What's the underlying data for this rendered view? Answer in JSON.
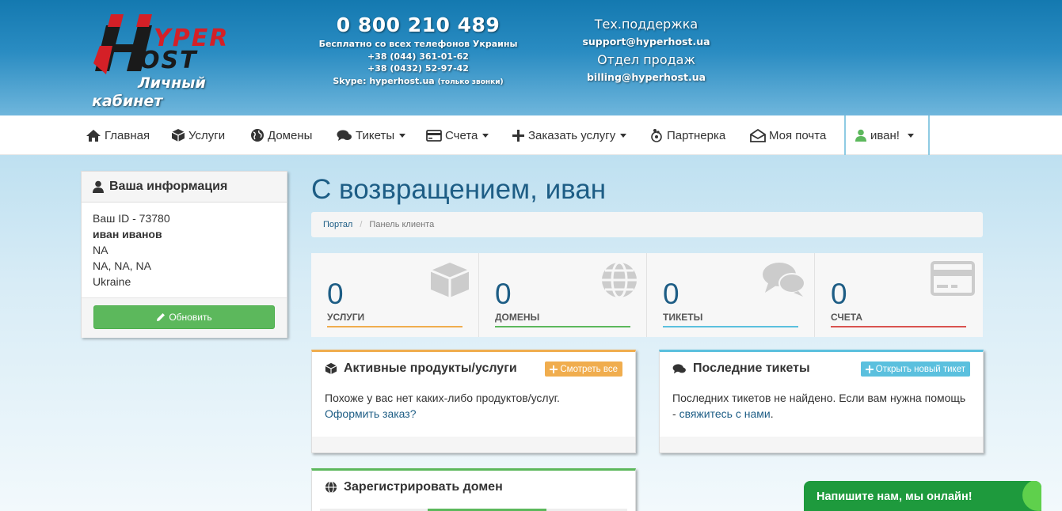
{
  "header": {
    "logo_text": "HYPER HOST",
    "logo_sub_line1": "Личный",
    "logo_sub_line2": "кабинет",
    "phone_main": "0 800 210 489",
    "phone_note": "Бесплатно со всех телефонов Украины",
    "phone_2": "+38 (044) 361-01-62",
    "phone_3": "+38 (0432) 52-97-42",
    "skype": "Skype: hyperhost.ua",
    "skype_note": "(только звонки)",
    "support_title": "Тех.поддержка",
    "support_email": "support@hyperhost.ua",
    "sales_title": "Отдел продаж",
    "sales_email": "billing@hyperhost.ua"
  },
  "nav": {
    "items": [
      {
        "label": "Главная",
        "icon": "home-icon"
      },
      {
        "label": "Услуги",
        "icon": "cube-icon"
      },
      {
        "label": "Домены",
        "icon": "globe-icon"
      },
      {
        "label": "Тикеты",
        "icon": "comments-icon",
        "dropdown": true
      },
      {
        "label": "Счета",
        "icon": "credit-card-icon",
        "dropdown": true
      },
      {
        "label": "Заказать услугу",
        "icon": "plus-icon",
        "dropdown": true
      },
      {
        "label": "Партнерка",
        "icon": "partner-icon"
      },
      {
        "label": "Моя почта",
        "icon": "envelope-icon"
      }
    ],
    "user_label": "иван!"
  },
  "sidebar": {
    "title": "Ваша информация",
    "id_line": "Ваш ID - 73780",
    "name": "иван иванов",
    "line3": "NA",
    "line4": "NA, NA, NA",
    "country": "Ukraine",
    "update_button": "Обновить"
  },
  "main": {
    "title": "С возвращением, иван",
    "breadcrumb": {
      "root": "Портал",
      "current": "Панель клиента"
    },
    "tiles": [
      {
        "value": "0",
        "label": "УСЛУГИ",
        "color": "#f0ad4e",
        "icon": "cube-icon"
      },
      {
        "value": "0",
        "label": "ДОМЕНЫ",
        "color": "#5cb85c",
        "icon": "globe-icon"
      },
      {
        "value": "0",
        "label": "ТИКЕТЫ",
        "color": "#5bc0de",
        "icon": "comments-icon"
      },
      {
        "value": "0",
        "label": "СЧЕТА",
        "color": "#d9534f",
        "icon": "credit-card-icon"
      }
    ],
    "products_panel": {
      "title": "Активные продукты/услуги",
      "button": "Смотреть все",
      "text": "Похоже у вас нет каких-либо продуктов/услуг.",
      "link": "Оформить заказ?"
    },
    "tickets_panel": {
      "title": "Последние тикеты",
      "button": "Открыть новый тикет",
      "text": "Последних тикетов не найдено. Если вам нужна помощь -",
      "link": "свяжитесь с нами",
      "end": "."
    },
    "domain_panel": {
      "title": "Зарегистрировать домен"
    }
  },
  "chat": {
    "label": "Напишите нам, мы онлайн!"
  }
}
